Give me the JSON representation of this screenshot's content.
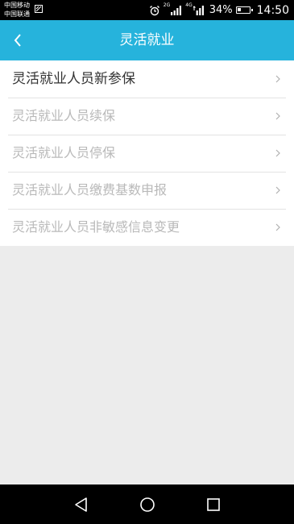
{
  "status_bar": {
    "carrier1": "中国移动",
    "carrier2": "中国联通",
    "net1": "2G",
    "net2": "4G",
    "battery": "34%",
    "battery_level": 0.34,
    "time": "14:50"
  },
  "header": {
    "title": "灵活就业"
  },
  "menu": {
    "items": [
      {
        "label": "灵活就业人员新参保",
        "enabled": true
      },
      {
        "label": "灵活就业人员续保",
        "enabled": false
      },
      {
        "label": "灵活就业人员停保",
        "enabled": false
      },
      {
        "label": "灵活就业人员缴费基数申报",
        "enabled": false
      },
      {
        "label": "灵活就业人员非敏感信息变更",
        "enabled": false
      }
    ]
  },
  "colors": {
    "header_bg": "#26b3dc",
    "active_text": "#333333",
    "disabled_text": "#b9b9b9",
    "page_bg": "#ececec"
  }
}
